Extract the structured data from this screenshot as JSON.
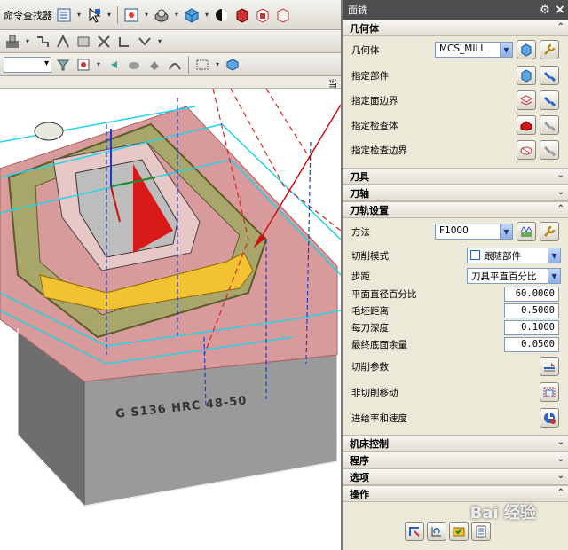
{
  "toolbar1": {
    "command_finder_label": "命令查找器"
  },
  "viewport": {
    "header_text": "当",
    "part_engraving": "G S136 HRC 48-50"
  },
  "dialog": {
    "title": "面铣",
    "geometry_section": {
      "title": "几何体",
      "geometry_label": "几何体",
      "geometry_value": "MCS_MILL",
      "specify_part": "指定部件",
      "specify_face_boundary": "指定面边界",
      "specify_check_body": "指定检查体",
      "specify_check_boundary": "指定检查边界"
    },
    "tool_section": "刀具",
    "axis_section": "刀轴",
    "path_settings": {
      "title": "刀轨设置",
      "method_label": "方法",
      "method_value": "F1000",
      "cut_pattern_label": "切削模式",
      "cut_pattern_value": "跟随部件",
      "stepover_label": "步距",
      "stepover_value": "刀具平直百分比",
      "flat_diameter_pct_label": "平面直径百分比",
      "flat_diameter_pct_value": "60.0000",
      "blank_distance_label": "毛坯距离",
      "blank_distance_value": "0.5000",
      "depth_per_cut_label": "每刀深度",
      "depth_per_cut_value": "0.1000",
      "final_floor_stock_label": "最终底面余量",
      "final_floor_stock_value": "0.0500",
      "cutting_params_label": "切削参数",
      "non_cutting_moves_label": "非切削移动",
      "feeds_speeds_label": "进给率和速度"
    },
    "machine_control_section": "机床控制",
    "program_section": "程序",
    "options_section": "选项",
    "actions_section": "操作",
    "watermark": "Bai 经验"
  },
  "colors": {
    "title_bar": "#4e4e4e",
    "dialog_bg": "#ece9d8",
    "arrow": "#d01010",
    "toolpath_cyan": "#21d4e8",
    "part_pink": "#d89a9a",
    "part_yellow": "#f2c233"
  }
}
